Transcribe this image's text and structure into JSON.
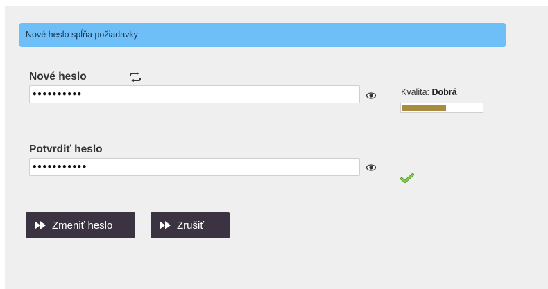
{
  "notice": {
    "text": "Nové heslo spĺňa požiadavky",
    "color": "#6ebff7"
  },
  "new_password": {
    "label": "Nové heslo",
    "value": "••••••••••",
    "generate_icon": "shuffle-icon",
    "toggle_icon": "eye-icon"
  },
  "quality": {
    "label": "Kvalita:",
    "value": "Dobrá",
    "strength_fraction": 0.55,
    "bar_color": "#a98b3f"
  },
  "confirm_password": {
    "label": "Potvrdiť heslo",
    "value": "•••••••••••",
    "toggle_icon": "eye-icon",
    "match_icon": "checkmark-icon",
    "match_color": "#6fbf3a"
  },
  "buttons": {
    "change_label": "Zmeniť heslo",
    "cancel_label": "Zrušiť",
    "icon": "fast-forward-icon",
    "color": "#3c3342"
  }
}
